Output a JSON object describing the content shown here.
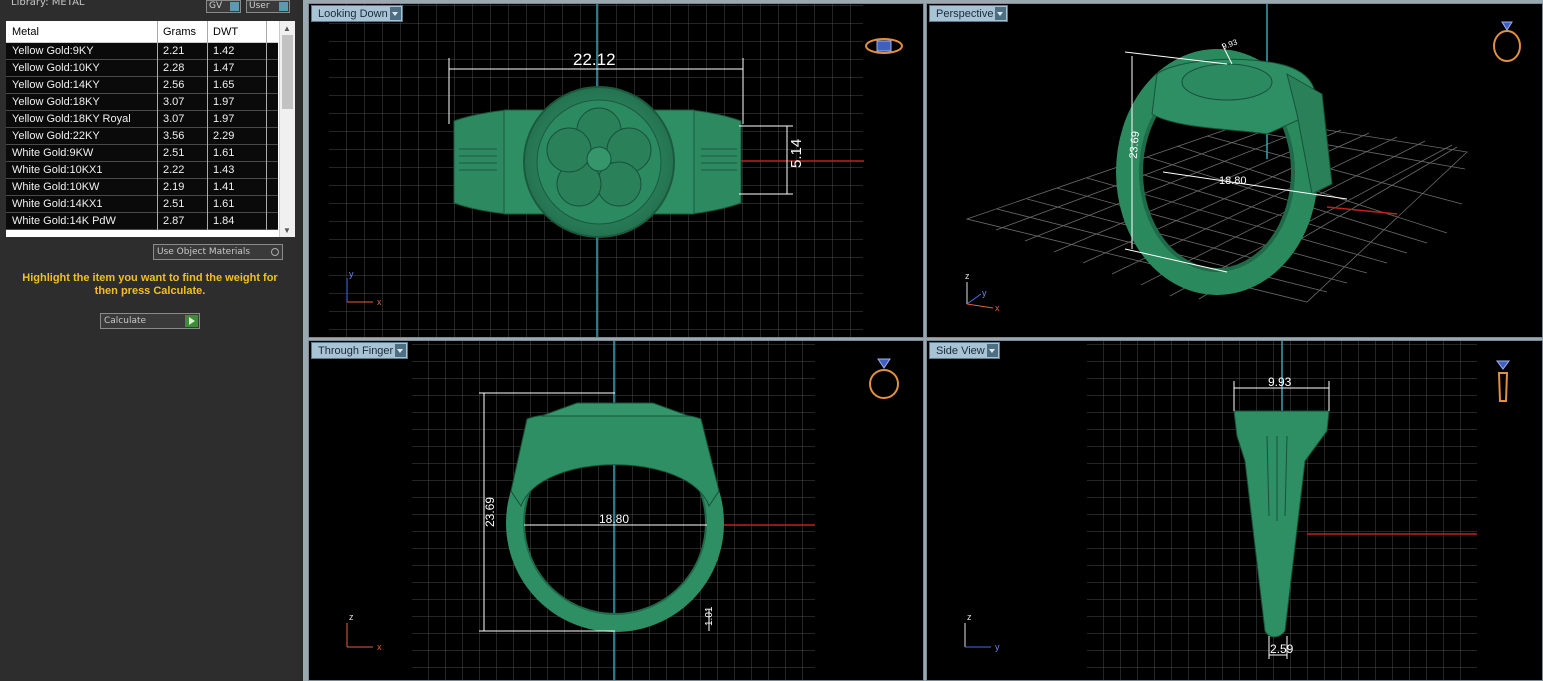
{
  "left_panel": {
    "library_title": "Library: METAL",
    "gv_label": "GV",
    "user_label": "User",
    "table": {
      "headers": [
        "Metal",
        "Grams",
        "DWT"
      ],
      "rows": [
        [
          "Yellow Gold:9KY",
          "2.21",
          "1.42"
        ],
        [
          "Yellow Gold:10KY",
          "2.28",
          "1.47"
        ],
        [
          "Yellow Gold:14KY",
          "2.56",
          "1.65"
        ],
        [
          "Yellow Gold:18KY",
          "3.07",
          "1.97"
        ],
        [
          "Yellow Gold:18KY Royal",
          "3.07",
          "1.97"
        ],
        [
          "Yellow Gold:22KY",
          "3.56",
          "2.29"
        ],
        [
          "White Gold:9KW",
          "2.51",
          "1.61"
        ],
        [
          "White Gold:10KX1",
          "2.22",
          "1.43"
        ],
        [
          "White Gold:10KW",
          "2.19",
          "1.41"
        ],
        [
          "White Gold:14KX1",
          "2.51",
          "1.61"
        ],
        [
          "White Gold:14K PdW",
          "2.87",
          "1.84"
        ]
      ]
    },
    "use_object_materials": "Use Object Materials",
    "hint_text": "Highlight the item you want to find the weight for then press Calculate.",
    "calculate_label": "Calculate"
  },
  "viewports": {
    "top": {
      "label": "Looking Down",
      "dims": {
        "width": "22.12",
        "height": "5.14"
      },
      "axes": {
        "vertical": "y",
        "horizontal": "x"
      }
    },
    "perspective": {
      "label": "Perspective",
      "dims": {
        "height": "23.69",
        "inner": "18.80",
        "top": "9.93"
      },
      "axes": {
        "vertical": "z",
        "depth": "y",
        "horizontal": "x"
      }
    },
    "front": {
      "label": "Through Finger",
      "dims": {
        "height": "23.69",
        "inner": "18.80",
        "thickness": "1.01"
      },
      "axes": {
        "vertical": "z",
        "horizontal": "x"
      }
    },
    "side": {
      "label": "Side View",
      "dims": {
        "top_width": "9.93",
        "bottom_width": "2.59"
      },
      "axes": {
        "vertical": "z",
        "horizontal": "y"
      }
    }
  },
  "colors": {
    "ring": "#2f8f64",
    "ring_dark": "#1f6a48",
    "grid": "#555555",
    "hint": "#f0c020",
    "axis_x": "#e06040",
    "axis_y": "#4070e0",
    "axis_z": "#e0e0e0"
  }
}
